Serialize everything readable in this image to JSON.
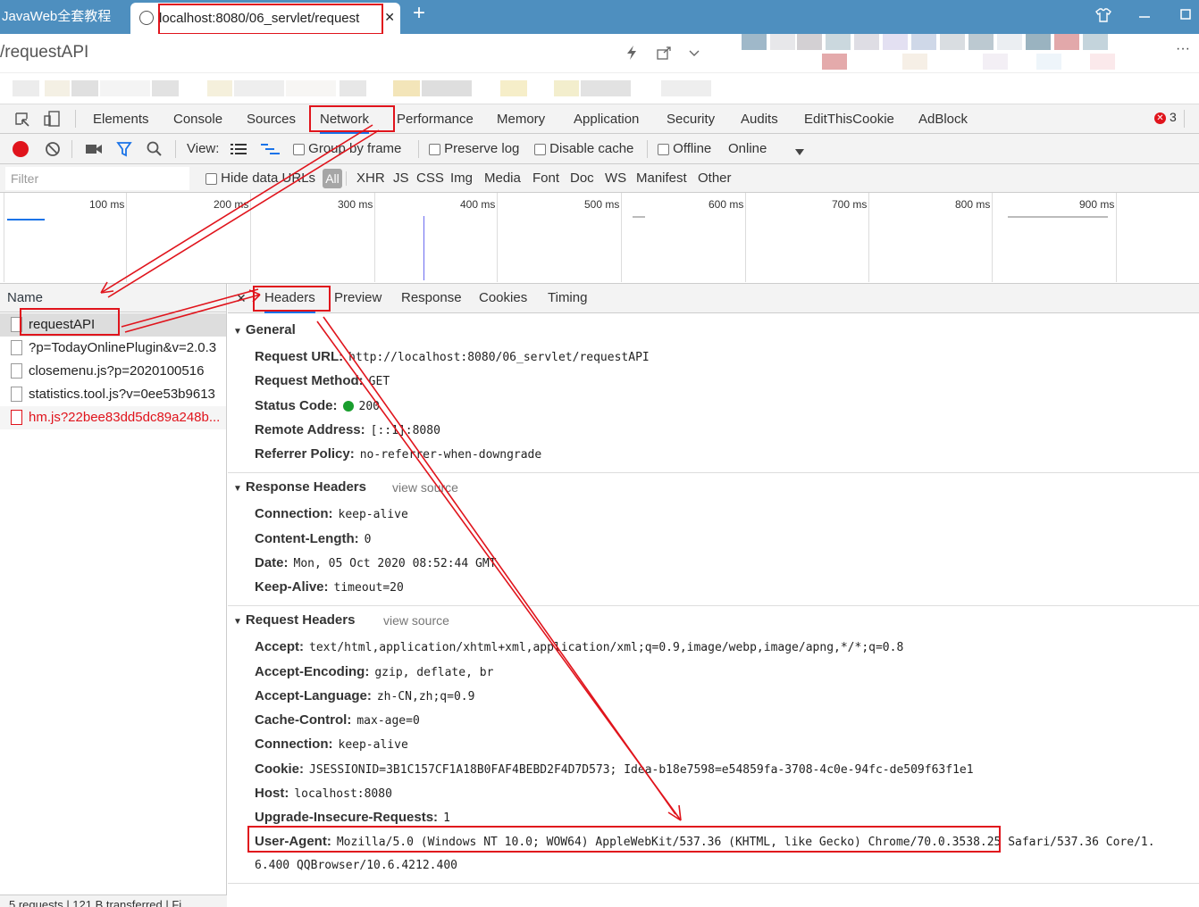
{
  "browser": {
    "tabs": [
      {
        "title": "JavaWeb全套教程",
        "active": false
      },
      {
        "title": "localhost:8080/06_servlet/request",
        "active": true
      }
    ],
    "new_tab": "+",
    "close_glyph": "✕",
    "page_title": "/requestAPI",
    "more": "···"
  },
  "devtools": {
    "tabs": [
      "Elements",
      "Console",
      "Sources",
      "Network",
      "Performance",
      "Memory",
      "Application",
      "Security",
      "Audits",
      "EditThisCookie",
      "AdBlock"
    ],
    "active_tab": "Network",
    "error_count": "3",
    "toolbar": {
      "view_label": "View:",
      "group_by_frame": "Group by frame",
      "preserve_log": "Preserve log",
      "disable_cache": "Disable cache",
      "offline": "Offline",
      "throttle": "Online"
    },
    "filter": {
      "placeholder": "Filter",
      "hide_data_urls": "Hide data URLs",
      "types": [
        "All",
        "XHR",
        "JS",
        "CSS",
        "Img",
        "Media",
        "Font",
        "Doc",
        "WS",
        "Manifest",
        "Other"
      ]
    },
    "timeline_ticks": [
      "100 ms",
      "200 ms",
      "300 ms",
      "400 ms",
      "500 ms",
      "600 ms",
      "700 ms",
      "800 ms",
      "900 ms"
    ],
    "name_header": "Name",
    "requests": [
      {
        "name": "requestAPI",
        "selected": true,
        "error": false
      },
      {
        "name": "?p=TodayOnlinePlugin&v=2.0.3",
        "selected": false,
        "error": false
      },
      {
        "name": "closemenu.js?p=2020100516",
        "selected": false,
        "error": false
      },
      {
        "name": "statistics.tool.js?v=0ee53b9613",
        "selected": false,
        "error": false
      },
      {
        "name": "hm.js?22bee83dd5dc89a248b...",
        "selected": false,
        "error": true
      }
    ],
    "status_bar": "5 requests | 121 B transferred | Fi",
    "detail_tabs": [
      "Headers",
      "Preview",
      "Response",
      "Cookies",
      "Timing"
    ],
    "detail_active": "Headers",
    "general": {
      "title": "General",
      "rows": [
        {
          "k": "Request URL:",
          "v": "http://localhost:8080/06_servlet/requestAPI"
        },
        {
          "k": "Request Method:",
          "v": "GET"
        },
        {
          "k": "Status Code:",
          "v": "200"
        },
        {
          "k": "Remote Address:",
          "v": "[::1]:8080"
        },
        {
          "k": "Referrer Policy:",
          "v": "no-referrer-when-downgrade"
        }
      ]
    },
    "response_headers": {
      "title": "Response Headers",
      "view_source": "view source",
      "rows": [
        {
          "k": "Connection:",
          "v": "keep-alive"
        },
        {
          "k": "Content-Length:",
          "v": "0"
        },
        {
          "k": "Date:",
          "v": "Mon, 05 Oct 2020 08:52:44 GMT"
        },
        {
          "k": "Keep-Alive:",
          "v": "timeout=20"
        }
      ]
    },
    "request_headers": {
      "title": "Request Headers",
      "view_source": "view source",
      "rows": [
        {
          "k": "Accept:",
          "v": "text/html,application/xhtml+xml,application/xml;q=0.9,image/webp,image/apng,*/*;q=0.8"
        },
        {
          "k": "Accept-Encoding:",
          "v": "gzip, deflate, br"
        },
        {
          "k": "Accept-Language:",
          "v": "zh-CN,zh;q=0.9"
        },
        {
          "k": "Cache-Control:",
          "v": "max-age=0"
        },
        {
          "k": "Connection:",
          "v": "keep-alive"
        },
        {
          "k": "Cookie:",
          "v": "JSESSIONID=3B1C157CF1A18B0FAF4BEBD2F4D7D573; Idea-b18e7598=e54859fa-3708-4c0e-94fc-de509f63f1e1"
        },
        {
          "k": "Host:",
          "v": "localhost:8080"
        },
        {
          "k": "Upgrade-Insecure-Requests:",
          "v": "1"
        },
        {
          "k": "User-Agent:",
          "v": "Mozilla/5.0 (Windows NT 10.0; WOW64) AppleWebKit/537.36 (KHTML, like Gecko) Chrome/70.0.3538.25 Safari/537.36 Core/1."
        }
      ],
      "wrap": "6.400 QQBrowser/10.6.4212.400"
    }
  },
  "colors": {
    "annotation": "#e0141c",
    "tabstrip": "#4e8fbf",
    "record": "#e0141c",
    "status_ok": "#1a9e2e",
    "link": "#1a73e8"
  }
}
